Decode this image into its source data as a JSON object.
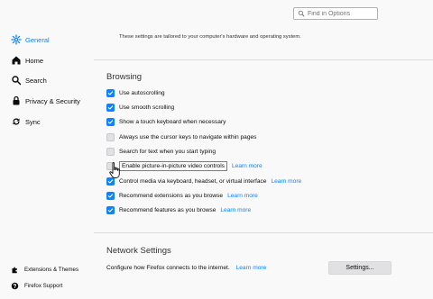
{
  "sidebar": {
    "items": [
      {
        "label": "General",
        "icon": "gear-icon",
        "active": true
      },
      {
        "label": "Home",
        "icon": "home-icon"
      },
      {
        "label": "Search",
        "icon": "search-icon"
      },
      {
        "label": "Privacy & Security",
        "icon": "lock-icon"
      },
      {
        "label": "Sync",
        "icon": "sync-icon"
      }
    ],
    "footer": [
      {
        "label": "Extensions & Themes",
        "icon": "puzzle-icon"
      },
      {
        "label": "Firefox Support",
        "icon": "help-icon"
      }
    ]
  },
  "search": {
    "placeholder": "Find in Options"
  },
  "performance": {
    "intro": "These settings are tailored to your computer's hardware and operating system."
  },
  "browsing": {
    "title": "Browsing",
    "options": [
      {
        "label": "Use autoscrolling",
        "checked": true
      },
      {
        "label": "Use smooth scrolling",
        "checked": true
      },
      {
        "label": "Show a touch keyboard when necessary",
        "checked": true
      },
      {
        "label": "Always use the cursor keys to navigate within pages",
        "checked": false
      },
      {
        "label": "Search for text when you start typing",
        "checked": false
      },
      {
        "label": "Enable picture-in-picture video controls",
        "checked": false,
        "link": "Learn more"
      },
      {
        "label": "Control media via keyboard, headset, or virtual interface",
        "checked": true,
        "link": "Learn more"
      },
      {
        "label": "Recommend extensions as you browse",
        "checked": true,
        "link": "Learn more"
      },
      {
        "label": "Recommend features as you browse",
        "checked": true,
        "link": "Learn more"
      }
    ]
  },
  "network": {
    "title": "Network Settings",
    "description": "Configure how Firefox connects to the internet.",
    "link": "Learn more",
    "button": "Settings..."
  },
  "colors": {
    "accent": "#0a84ff",
    "background": "#f9f9fa"
  }
}
